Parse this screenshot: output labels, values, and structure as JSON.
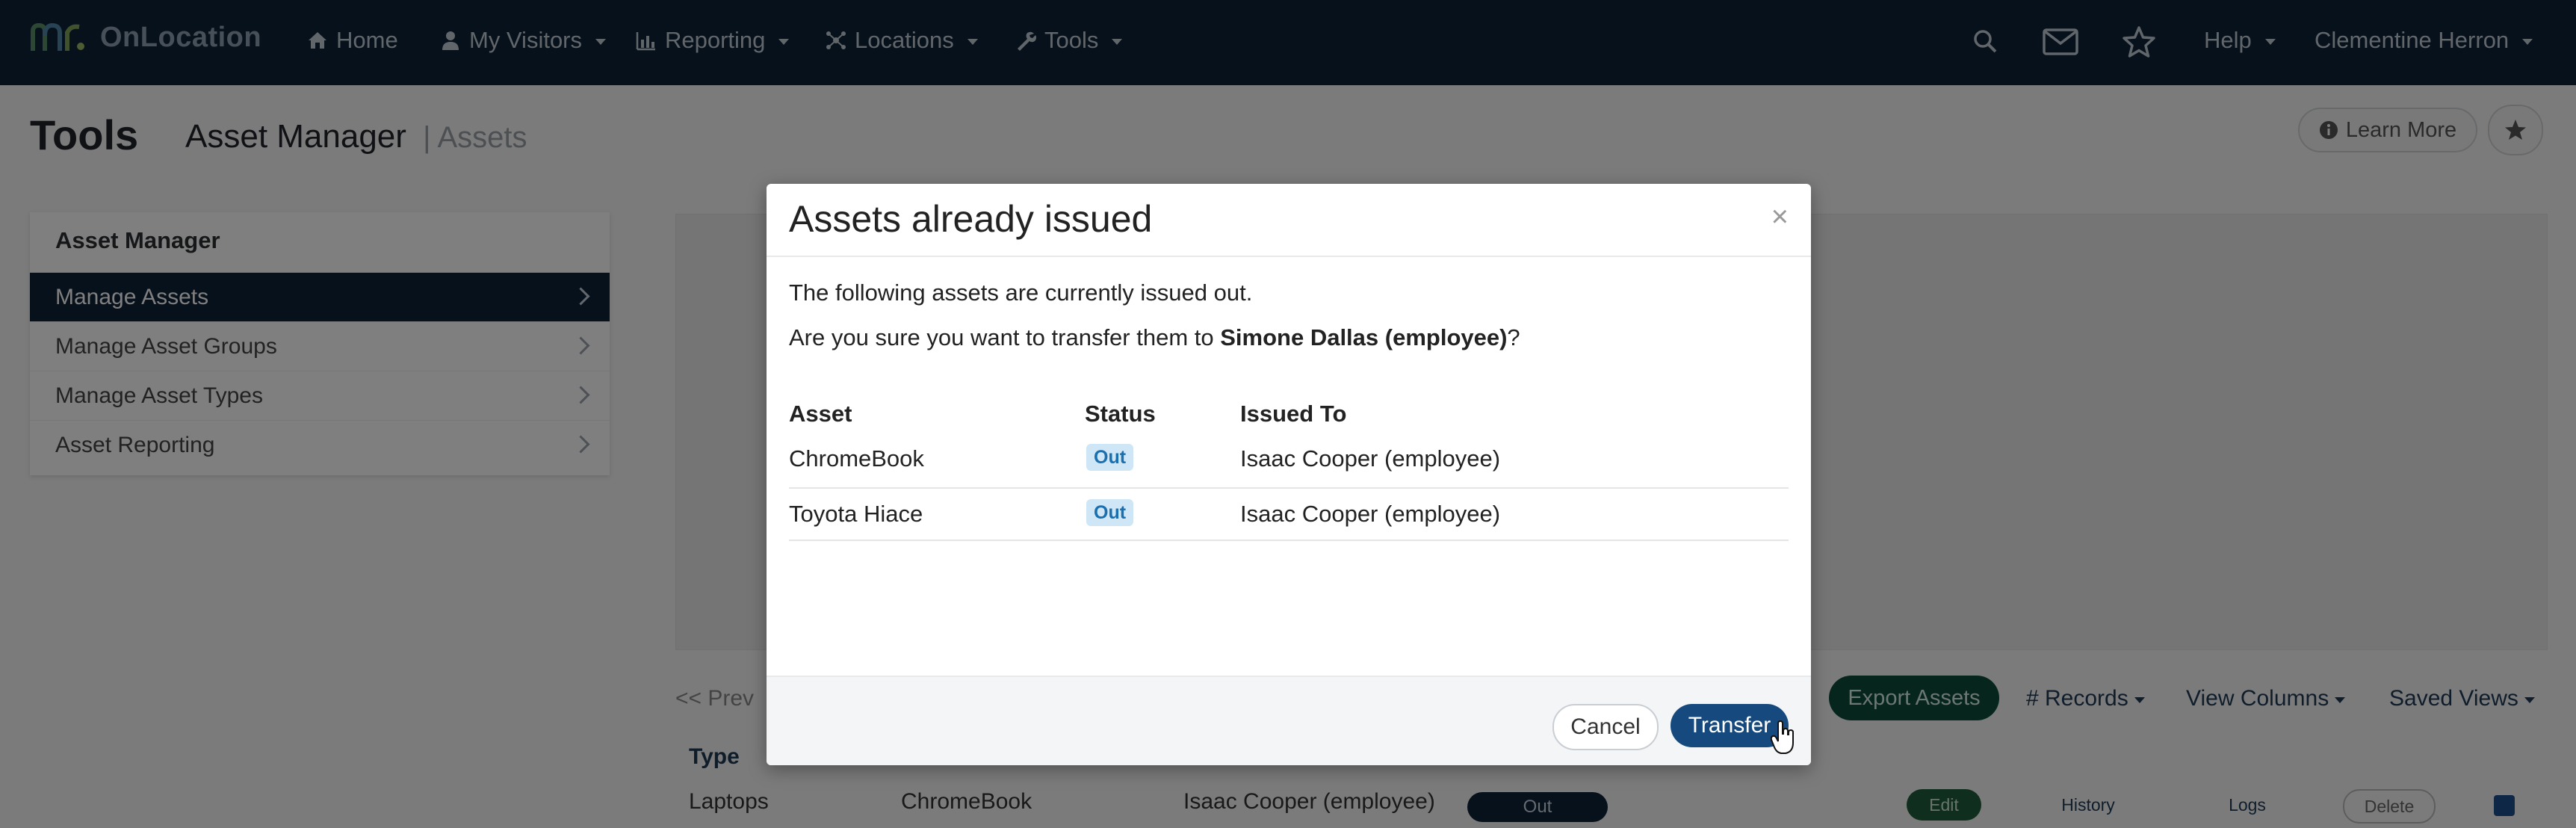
{
  "app": {
    "name": "OnLocation"
  },
  "nav": {
    "home": "Home",
    "my_visitors": "My Visitors",
    "reporting": "Reporting",
    "locations": "Locations",
    "tools": "Tools",
    "help": "Help",
    "user": "Clementine Herron"
  },
  "page": {
    "title": "Tools",
    "section": "Asset Manager",
    "subsection": "| Assets",
    "learn_more": "Learn More"
  },
  "sidebar": {
    "heading": "Asset Manager",
    "items": [
      {
        "label": "Manage Assets",
        "active": true
      },
      {
        "label": "Manage Asset Groups",
        "active": false
      },
      {
        "label": "Manage Asset Types",
        "active": false
      },
      {
        "label": "Asset Reporting",
        "active": false
      }
    ]
  },
  "toolbar": {
    "prev": "<< Prev",
    "export": "Export Assets",
    "records": "# Records",
    "view_columns": "View Columns",
    "saved_views": "Saved Views"
  },
  "table": {
    "type_header": "Type",
    "row": {
      "type": "Laptops",
      "asset": "ChromeBook",
      "issued_to": "Isaac Cooper (employee)",
      "status": "Out",
      "edit": "Edit",
      "history": "History",
      "logs": "Logs",
      "delete": "Delete"
    }
  },
  "modal": {
    "title": "Assets already issued",
    "close": "×",
    "line1": "The following assets are currently issued out.",
    "line2_prefix": "Are you sure you want to transfer them to ",
    "line2_bold": "Simone Dallas (employee)",
    "line2_suffix": "?",
    "columns": [
      "Asset",
      "Status",
      "Issued To"
    ],
    "rows": [
      {
        "asset": "ChromeBook",
        "status": "Out",
        "issued_to": "Isaac Cooper (employee)"
      },
      {
        "asset": "Toyota Hiace",
        "status": "Out",
        "issued_to": "Isaac Cooper (employee)"
      }
    ],
    "cancel": "Cancel",
    "transfer": "Transfer"
  },
  "colors": {
    "nav_bg": "#0f2338",
    "primary": "#164a7e",
    "export_green": "#0b4a3a",
    "status_badge": "#cfe6f7"
  }
}
